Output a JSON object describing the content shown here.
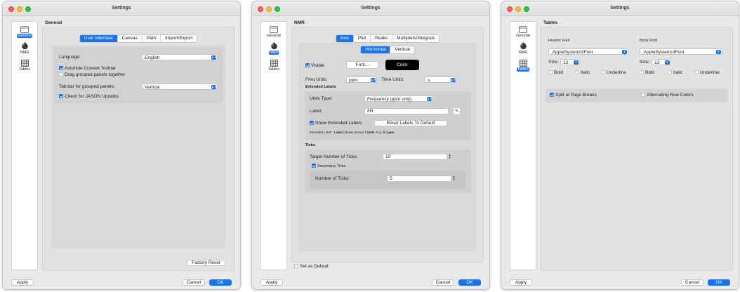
{
  "common": {
    "window_title": "Settings",
    "sidebar": [
      "General",
      "NMR",
      "Tables"
    ],
    "apply_label": "Apply",
    "cancel_label": "Cancel",
    "ok_label": "OK",
    "accent_color": "#1a73e8"
  },
  "general": {
    "section_title": "General",
    "tabs": [
      "User Interface",
      "Canvas",
      "Path",
      "Import/Export"
    ],
    "language_label": "Language:",
    "language_value": "English",
    "autohide_label": "Autohide Context Toolbar",
    "autohide_checked": true,
    "drag_label": "Drag grouped panels together",
    "drag_checked": false,
    "tabbar_label": "Tab bar for grouped panels:",
    "tabbar_value": "Vertical",
    "updates_label": "Check for JASON Updates",
    "updates_checked": true,
    "factory_reset_label": "Factory Reset"
  },
  "nmr": {
    "section_title": "NMR",
    "tabs": [
      "Axis",
      "Plot",
      "Peaks",
      "Multiplets/Integrals"
    ],
    "orient_tabs": [
      "Horizontal",
      "Vertical"
    ],
    "visible_label": "Visible",
    "font_label": "Font...",
    "color_label": "Color",
    "freq_units_label": "Freq Units:",
    "freq_units_value": "ppm",
    "time_units_label": "Time Units:",
    "time_units_value": "s",
    "extended_labels_title": "Extended Labels",
    "units_type_label": "Units Type:",
    "units_type_value": "Frequency (ppm only)",
    "label_label": "Label:",
    "label_value": "δH",
    "show_extended_label": "Show Extended Labels",
    "reset_labels_label": "Reset Labels To Default",
    "extended_hint_prefix": "Extended Label : ",
    "extended_hint_label": "Label",
    "extended_hint_mid": " (shown above) ",
    "extended_hint_units": "/ Units",
    "extended_hint_eg": ". E.g. ",
    "extended_hint_example": "δ / ppm",
    "ticks_title": "Ticks",
    "target_ticks_label": "Target Number of Ticks:",
    "target_ticks_value": "10",
    "secondary_ticks_label": "Secondary Ticks",
    "number_ticks_label": "Number of Ticks:",
    "number_ticks_value": "5",
    "set_default_label": "Set as Default"
  },
  "tables": {
    "section_title": "Tables",
    "header_font_title": "Header Font",
    "header_font_value": ".AppleSystemUIFont",
    "header_size_label": "Size:",
    "header_size_value": "13",
    "body_font_title": "Body Font",
    "body_font_value": ".AppleSystemUIFont",
    "body_size_label": "Size:",
    "body_size_value": "13",
    "bold_label": "Bold",
    "italic_label": "Italic",
    "underline_label": "Underline",
    "split_label": "Split at Page Breaks",
    "alternating_label": "Alternating Row Colors"
  }
}
